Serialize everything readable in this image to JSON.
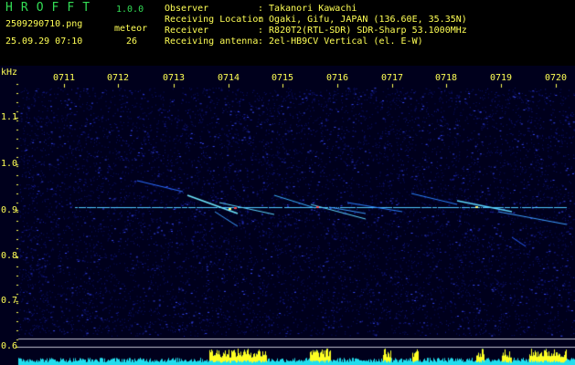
{
  "header": {
    "title": "H R O F F T",
    "version": "1.0.0",
    "filename": "2509290710.png",
    "datetime": "25.09.29 07:10",
    "meteor_label": "meteor",
    "meteor_count": "26",
    "info": [
      {
        "label": "Observer",
        "value": ": Takanori Kawachi"
      },
      {
        "label": "Receiving Location",
        "value": ": Ogaki, Gifu, JAPAN (136.60E, 35.35N)"
      },
      {
        "label": "Receiver",
        "value": ": R820T2(RTL-SDR) SDR-Sharp 53.1000MHz"
      },
      {
        "label": "Receiving antenna",
        "value": ": 2el-HB9CV Vertical (el. E-W)"
      }
    ]
  },
  "spectrogram": {
    "y_unit": "kHz",
    "y_labels": [
      "1.1",
      "1.0",
      "0.9",
      "0.8",
      "0.7",
      "0.6"
    ],
    "time_labels": [
      "0711",
      "0712",
      "0713",
      "0714",
      "0715",
      "0716",
      "0717",
      "0718",
      "0719",
      "0720"
    ]
  },
  "colors": {
    "text_yellow": "#ffff55",
    "text_green": "#33dd55",
    "carrier": "#66ddff",
    "meter_cyan": "#22ddee",
    "meter_yellow": "#ffff22"
  }
}
